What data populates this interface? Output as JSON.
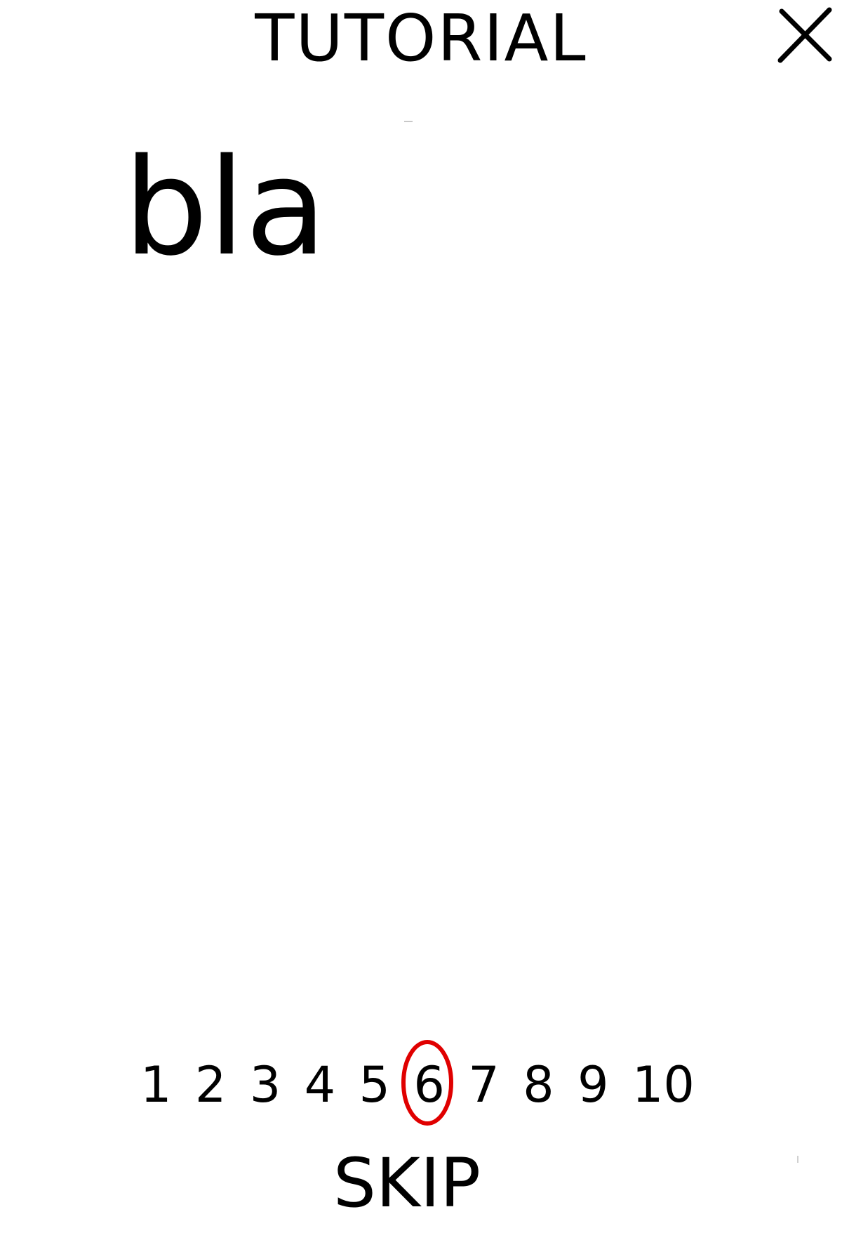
{
  "header": {
    "title": "TUTORIAL",
    "close_label": "X"
  },
  "content": {
    "text": "bla"
  },
  "pager": {
    "pages": [
      "1",
      "2",
      "3",
      "4",
      "5",
      "6",
      "7",
      "8",
      "9",
      "10"
    ],
    "current_page": 6,
    "highlight_color": "#e00000"
  },
  "footer": {
    "skip_label": "SKIP"
  }
}
